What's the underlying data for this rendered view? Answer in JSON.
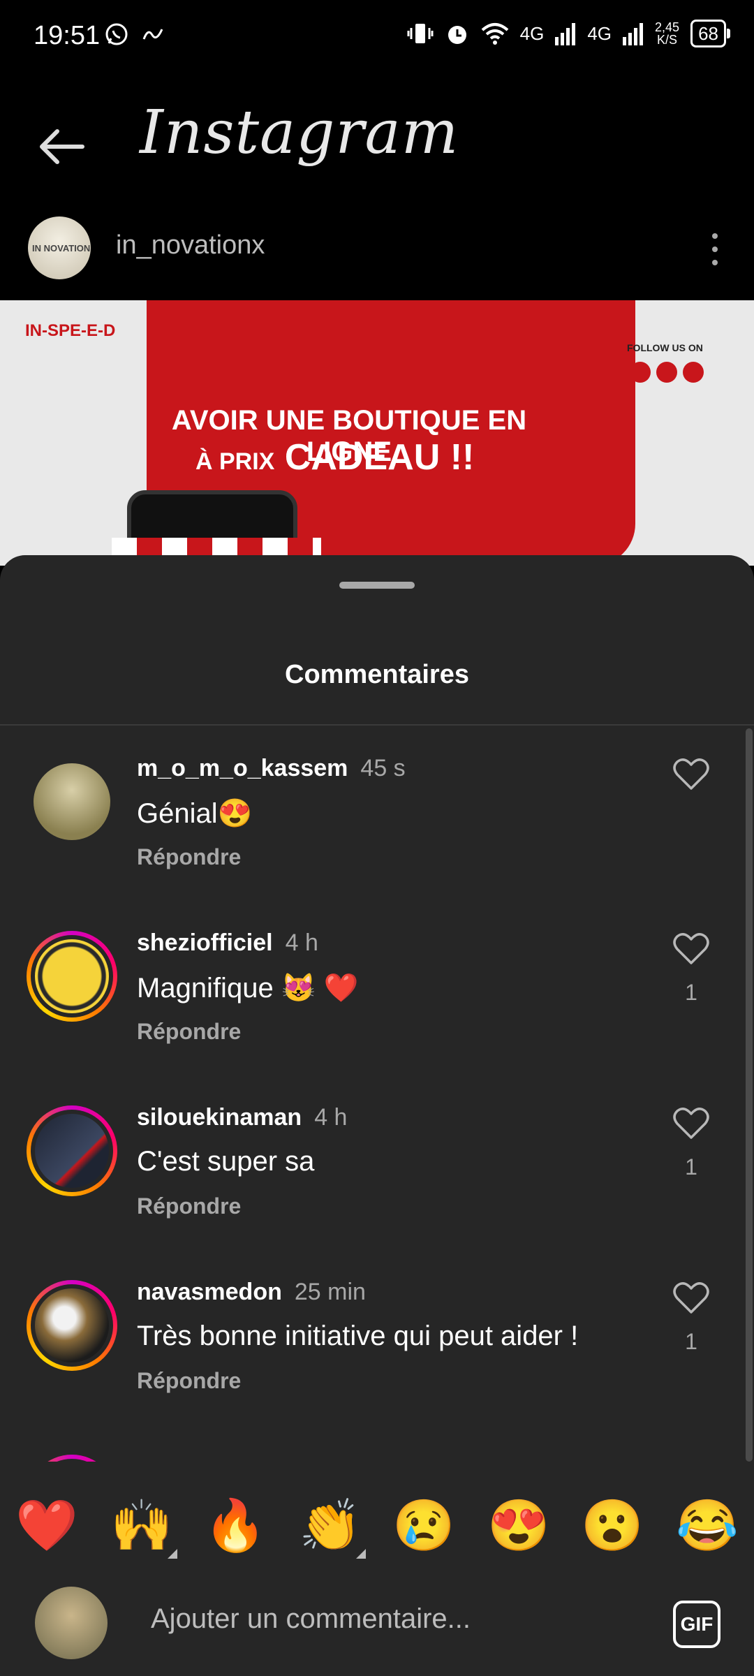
{
  "status": {
    "time": "19:51",
    "net1": "4G",
    "net2": "4G",
    "speed_top": "2,45",
    "speed_bottom": "K/S",
    "battery": "68"
  },
  "header": {
    "logo": "Instagram"
  },
  "post": {
    "username": "in_novationx",
    "avatar_text": "IN NOVATION",
    "image_logo": "IN-SPE-E-D",
    "image_follow": "FOLLOW US ON",
    "image_title_line1": "AVOIR UNE BOUTIQUE EN LIGNE",
    "image_title_line2_small": "À PRIX",
    "image_title_line2": "CADEAU !!"
  },
  "sheet": {
    "title": "Commentaires",
    "reply_label": "Répondre"
  },
  "comments": [
    {
      "user": "m_o_m_o_kassem",
      "time": "45 s",
      "text": "Génial😍",
      "likes": ""
    },
    {
      "user": "sheziofficiel",
      "time": "4 h",
      "text": "Magnifique 😻 ❤️",
      "likes": "1"
    },
    {
      "user": "silouekinaman",
      "time": "4 h",
      "text": "C'est super sa",
      "likes": "1"
    },
    {
      "user": "navasmedon",
      "time": "25 min",
      "text": "Très bonne initiative qui peut aider !",
      "likes": "1"
    },
    {
      "user": "",
      "time": "",
      "text": "",
      "likes": ""
    }
  ],
  "emojis": [
    "❤️",
    "🙌",
    "🔥",
    "👏",
    "😢",
    "😍",
    "😮",
    "😂"
  ],
  "input": {
    "placeholder": "Ajouter un commentaire...",
    "gif_label": "GIF"
  }
}
